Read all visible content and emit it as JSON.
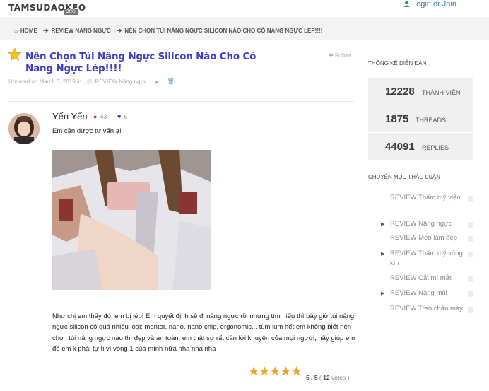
{
  "header": {
    "logo": "TAMSUDAOKEO",
    "logo_sub": "ORG",
    "login": "Login or Join"
  },
  "breadcrumb": {
    "items": [
      "HOME",
      "REVIEW Nâng ngực",
      "NÊN CHỌN TÚI NÂNG NGỰC SILICON NÀO CHO CÔ NANG NGỰC LÉP!!!!"
    ]
  },
  "thread": {
    "title": "Nên Chọn Túi Nâng Ngực Silicon Nào Cho Cô Nang Ngực Lép!!!!",
    "follow": "Follow",
    "meta_updated": "Updated on March 5, 2019 in",
    "meta_category": "REVIEW Nâng ngực"
  },
  "post": {
    "author": "Yến Yến",
    "comments": "43",
    "likes": "6",
    "intro": "Em cần được tư vấn ạ!",
    "body": "Như chị em thấy đó, em bị lép! Em quyết định sẽ đi nâng ngực rồi nhưng tìm hiểu thì bây giờ túi nâng ngực silicon có quá nhiều loại: mentor, nano, nano chip, ergonomic,.. tùm lum hết em không biết nên chọn túi nâng ngực nào thì đẹp và an toàn, em thật sự rất cần lời khuyên của mọi người, hãy giúp em để em k phải tự ti vì vòng 1 của mình nữa nha nha nha",
    "rating_value": "5",
    "rating_max": "5",
    "rating_votes": "12",
    "rating_votes_label": "votes"
  },
  "sidebar": {
    "stats_title": "THỐNG KÊ DIỄN ĐÀN",
    "stats": [
      {
        "value": "12228",
        "label": "THÀNH VIÊN"
      },
      {
        "value": "1875",
        "label": "THREADS"
      },
      {
        "value": "44091",
        "label": "REPLIES"
      }
    ],
    "categories_title": "CHUYÊN MỤC THẢO LUẬN",
    "categories": [
      {
        "label": "REVIEW Thẩm mỹ viện",
        "expandable": false
      },
      {
        "label": "REVIEW Nâng ngực",
        "expandable": true
      },
      {
        "label": "REVIEW Mẹo làm đẹp",
        "expandable": false
      },
      {
        "label": "REVIEW Thẩm mỹ vùng kín",
        "expandable": true
      },
      {
        "label": "REVIEW Cắt mí mắt",
        "expandable": false
      },
      {
        "label": "REVIEW Nâng mũi",
        "expandable": true
      },
      {
        "label": "REVIEW Treo chân mày",
        "expandable": false
      }
    ]
  },
  "colors": {
    "title": "#3b3ec8",
    "link": "#2e86c1",
    "star": "#f0a11c",
    "comment_icon": "#e02020",
    "heart_icon": "#2236c9"
  }
}
